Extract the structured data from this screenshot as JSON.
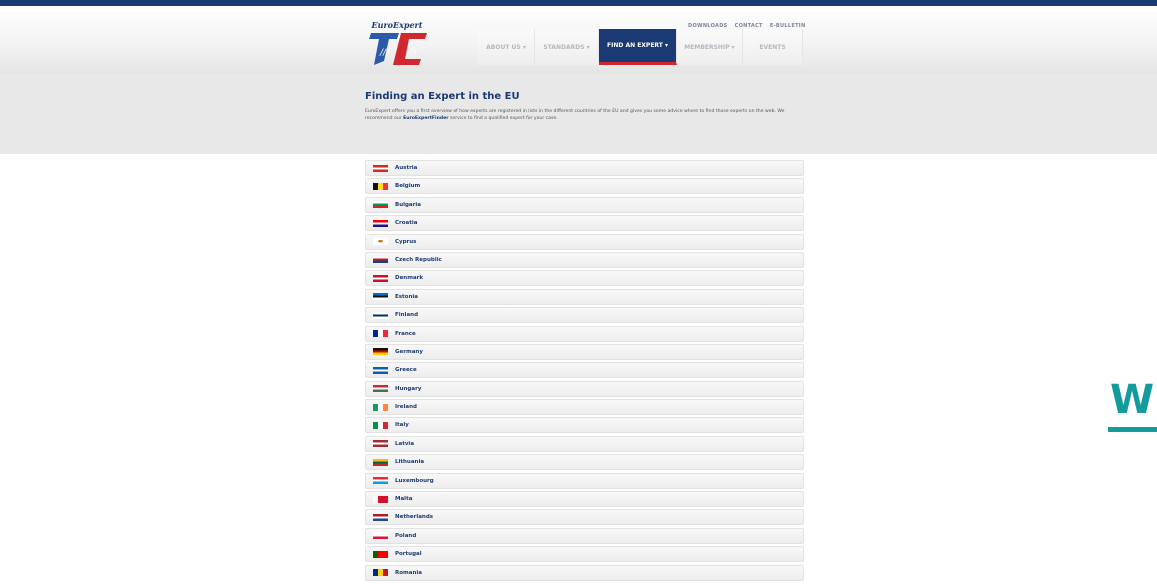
{
  "header": {
    "logo_text": "EuroExpert",
    "top_links": [
      "DOWNLOADS",
      "CONTACT",
      "E-BULLETIN"
    ],
    "nav": [
      {
        "label": "ABOUT US",
        "has_dropdown": true,
        "active": false
      },
      {
        "label": "STANDARDS",
        "has_dropdown": true,
        "active": false
      },
      {
        "label": "FIND AN EXPERT",
        "has_dropdown": true,
        "active": true
      },
      {
        "label": "MEMBERSHIP",
        "has_dropdown": true,
        "active": false
      },
      {
        "label": "EVENTS",
        "has_dropdown": false,
        "active": false
      }
    ]
  },
  "main": {
    "title": "Finding an Expert in the EU",
    "intro_before": "EuroExpert offers you a first overview of how experts are registered in lists in the different countries of the EU and gives you some advice where to find those experts on the web. We recommend our ",
    "intro_link": "EuroExpertFinder",
    "intro_after": " service to find a qualified expert for your case."
  },
  "countries": [
    {
      "name": "Austria",
      "flag": "austria-flag",
      "stripes": "h",
      "colors": [
        "#d52b1e",
        "#ffffff",
        "#d52b1e"
      ]
    },
    {
      "name": "Belgium",
      "flag": "belgium-flag",
      "stripes": "v",
      "colors": [
        "#111111",
        "#fdda24",
        "#ef3340"
      ]
    },
    {
      "name": "Bulgaria",
      "flag": "bulgaria-flag",
      "stripes": "h",
      "colors": [
        "#ffffff",
        "#00966e",
        "#d62612"
      ]
    },
    {
      "name": "Croatia",
      "flag": "croatia-flag",
      "stripes": "h",
      "colors": [
        "#ff0000",
        "#ffffff",
        "#171796"
      ]
    },
    {
      "name": "Cyprus",
      "flag": "cyprus-flag",
      "stripes": "h",
      "colors": [
        "#ffffff",
        "#ffffff",
        "#ffffff"
      ]
    },
    {
      "name": "Czech Republic",
      "flag": "czech-republic-flag",
      "stripes": "h",
      "colors": [
        "#ffffff",
        "#d7141a",
        "#11457e"
      ]
    },
    {
      "name": "Denmark",
      "flag": "denmark-flag",
      "stripes": "h",
      "colors": [
        "#c8102e",
        "#ffffff",
        "#c8102e"
      ]
    },
    {
      "name": "Estonia",
      "flag": "estonia-flag",
      "stripes": "h",
      "colors": [
        "#0072ce",
        "#111111",
        "#ffffff"
      ]
    },
    {
      "name": "Finland",
      "flag": "finland-flag",
      "stripes": "h",
      "colors": [
        "#ffffff",
        "#002f6c",
        "#ffffff"
      ]
    },
    {
      "name": "France",
      "flag": "france-flag",
      "stripes": "v",
      "colors": [
        "#002395",
        "#ffffff",
        "#ed2939"
      ]
    },
    {
      "name": "Germany",
      "flag": "germany-flag",
      "stripes": "h",
      "colors": [
        "#111111",
        "#dd0000",
        "#ffce00"
      ]
    },
    {
      "name": "Greece",
      "flag": "greece-flag",
      "stripes": "h",
      "colors": [
        "#0d5eaf",
        "#ffffff",
        "#0d5eaf"
      ]
    },
    {
      "name": "Hungary",
      "flag": "hungary-flag",
      "stripes": "h",
      "colors": [
        "#ce2939",
        "#ffffff",
        "#477050"
      ]
    },
    {
      "name": "Ireland",
      "flag": "ireland-flag",
      "stripes": "v",
      "colors": [
        "#169b62",
        "#ffffff",
        "#ff883e"
      ]
    },
    {
      "name": "Italy",
      "flag": "italy-flag",
      "stripes": "v",
      "colors": [
        "#009246",
        "#ffffff",
        "#ce2b37"
      ]
    },
    {
      "name": "Latvia",
      "flag": "latvia-flag",
      "stripes": "h",
      "colors": [
        "#9e3039",
        "#ffffff",
        "#9e3039"
      ]
    },
    {
      "name": "Lithuania",
      "flag": "lithuania-flag",
      "stripes": "h",
      "colors": [
        "#fdb913",
        "#006a44",
        "#c1272d"
      ]
    },
    {
      "name": "Luxembourg",
      "flag": "luxembourg-flag",
      "stripes": "h",
      "colors": [
        "#ed2939",
        "#ffffff",
        "#00a1de"
      ]
    },
    {
      "name": "Malta",
      "flag": "malta-flag",
      "stripes": "v",
      "colors": [
        "#ffffff",
        "#cf142b",
        "#cf142b"
      ]
    },
    {
      "name": "Netherlands",
      "flag": "netherlands-flag",
      "stripes": "h",
      "colors": [
        "#ae1c28",
        "#ffffff",
        "#21468b"
      ]
    },
    {
      "name": "Poland",
      "flag": "poland-flag",
      "stripes": "h",
      "colors": [
        "#ffffff",
        "#ffffff",
        "#dc143c"
      ]
    },
    {
      "name": "Portugal",
      "flag": "portugal-flag",
      "stripes": "v",
      "colors": [
        "#006600",
        "#ff0000",
        "#ff0000"
      ]
    },
    {
      "name": "Romania",
      "flag": "romania-flag",
      "stripes": "v",
      "colors": [
        "#002b7f",
        "#fcd116",
        "#ce1126"
      ]
    }
  ],
  "side_logo": {
    "letter": "W",
    "color": "#149c9c"
  }
}
